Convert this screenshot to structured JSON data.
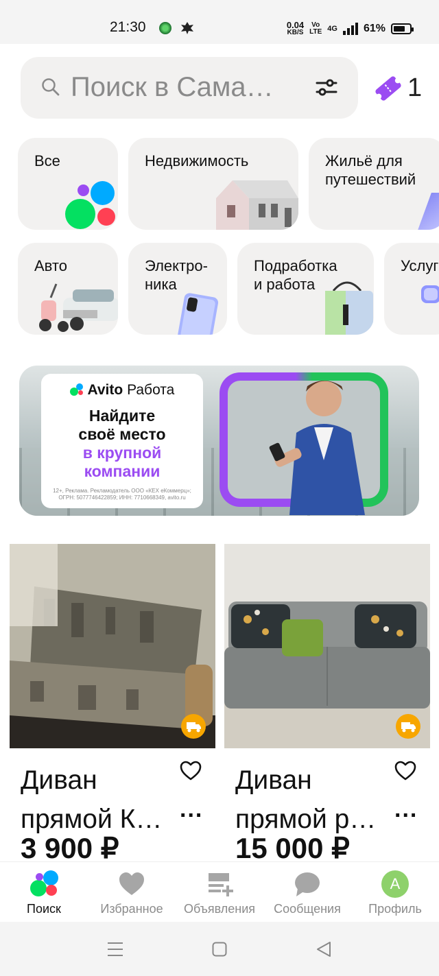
{
  "status": {
    "time": "21:30",
    "speed_value": "0.04",
    "speed_unit": "KB/S",
    "volte_top": "Vo",
    "volte_bottom": "LTE",
    "network": "4G",
    "battery": "61%",
    "battery_level": 0.61
  },
  "search": {
    "placeholder": "Поиск в Сама…",
    "cart_count": "1"
  },
  "categories": [
    {
      "label": "Все"
    },
    {
      "label": "Недвижимость"
    },
    {
      "label": "Жильё для\nпутешествий"
    },
    {
      "label": "Авто"
    },
    {
      "label": "Электро-\nника"
    },
    {
      "label": "Подработка\nи работа"
    },
    {
      "label": "Услуг"
    }
  ],
  "banner": {
    "brand_avito": "Avito",
    "brand_rabota": "Работа",
    "line1": "Найдите",
    "line2": "своё место",
    "line3": "в крупной",
    "line4": "компании",
    "fine": "12+, Реклама. Рекламодатель ООО «КЕХ еКоммерц»; ОГРН: 5077746422859; ИНН: 7710668349, avito.ru"
  },
  "listings": [
    {
      "title_line1": "Диван",
      "title_line2": "прямой К…",
      "more": "...",
      "price": "3 900 ₽"
    },
    {
      "title_line1": "Диван",
      "title_line2": "прямой р…",
      "more": "...",
      "price": "15 000 ₽"
    }
  ],
  "tabs": [
    {
      "label": "Поиск"
    },
    {
      "label": "Избранное"
    },
    {
      "label": "Объявления"
    },
    {
      "label": "Сообщения"
    },
    {
      "label": "Профиль",
      "avatar_letter": "A"
    }
  ],
  "colors": {
    "accent_violet": "#9b4cf2",
    "avito_blue": "#0af",
    "avito_green": "#04e061",
    "avito_red": "#ff4053",
    "delivery_orange": "#f7a600",
    "avatar_green": "#8ed16b"
  }
}
